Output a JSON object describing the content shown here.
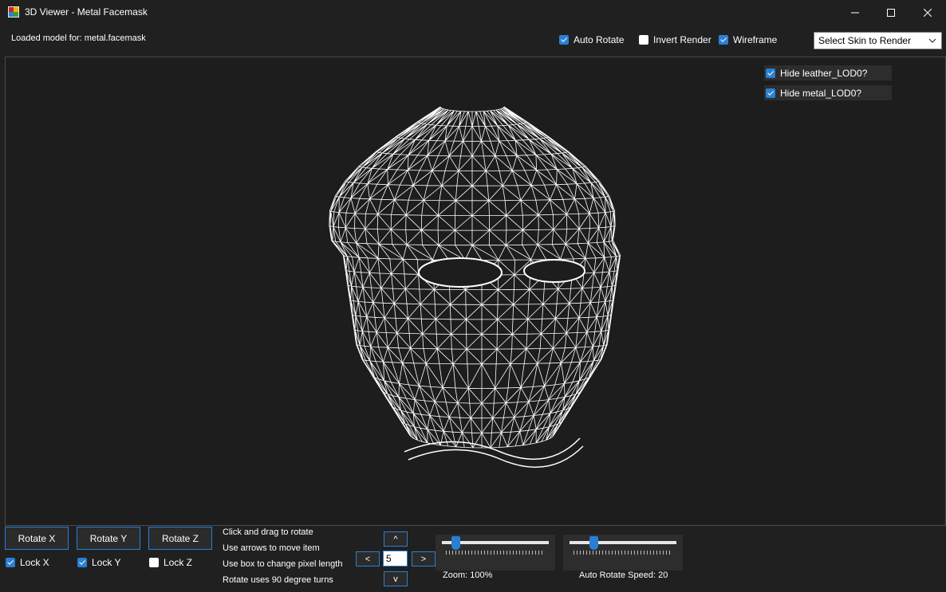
{
  "window": {
    "title": "3D Viewer - Metal Facemask"
  },
  "toolbar": {
    "status": "Loaded model for: metal.facemask",
    "auto_rotate": {
      "label": "Auto Rotate",
      "checked": true
    },
    "invert_render": {
      "label": "Invert Render",
      "checked": false
    },
    "wireframe": {
      "label": "Wireframe",
      "checked": true
    },
    "skin_select": {
      "value": "Select Skin to Render"
    }
  },
  "viewport": {
    "hide_options": [
      {
        "label": "Hide leather_LOD0?",
        "checked": true
      },
      {
        "label": "Hide metal_LOD0?",
        "checked": true
      }
    ]
  },
  "controls": {
    "rotate_x": "Rotate X",
    "rotate_y": "Rotate Y",
    "rotate_z": "Rotate Z",
    "lock_x": {
      "label": "Lock X",
      "checked": true
    },
    "lock_y": {
      "label": "Lock Y",
      "checked": true
    },
    "lock_z": {
      "label": "Lock Z",
      "checked": false
    },
    "hints": [
      "Click and drag to rotate",
      "Use arrows to move item",
      "Use box to change pixel length",
      "Rotate uses 90 degree turns"
    ],
    "arrows": {
      "up": "^",
      "down": "v",
      "left": "<",
      "right": ">"
    },
    "pixel_length": "5",
    "zoom": {
      "label": "Zoom: 100%",
      "fraction": 0.1
    },
    "rotate_speed": {
      "label": "Auto Rotate Speed: 20",
      "fraction": 0.2
    }
  },
  "colors": {
    "accent": "#2a7fd4",
    "background": "#202020",
    "wire": "#ffffff"
  }
}
